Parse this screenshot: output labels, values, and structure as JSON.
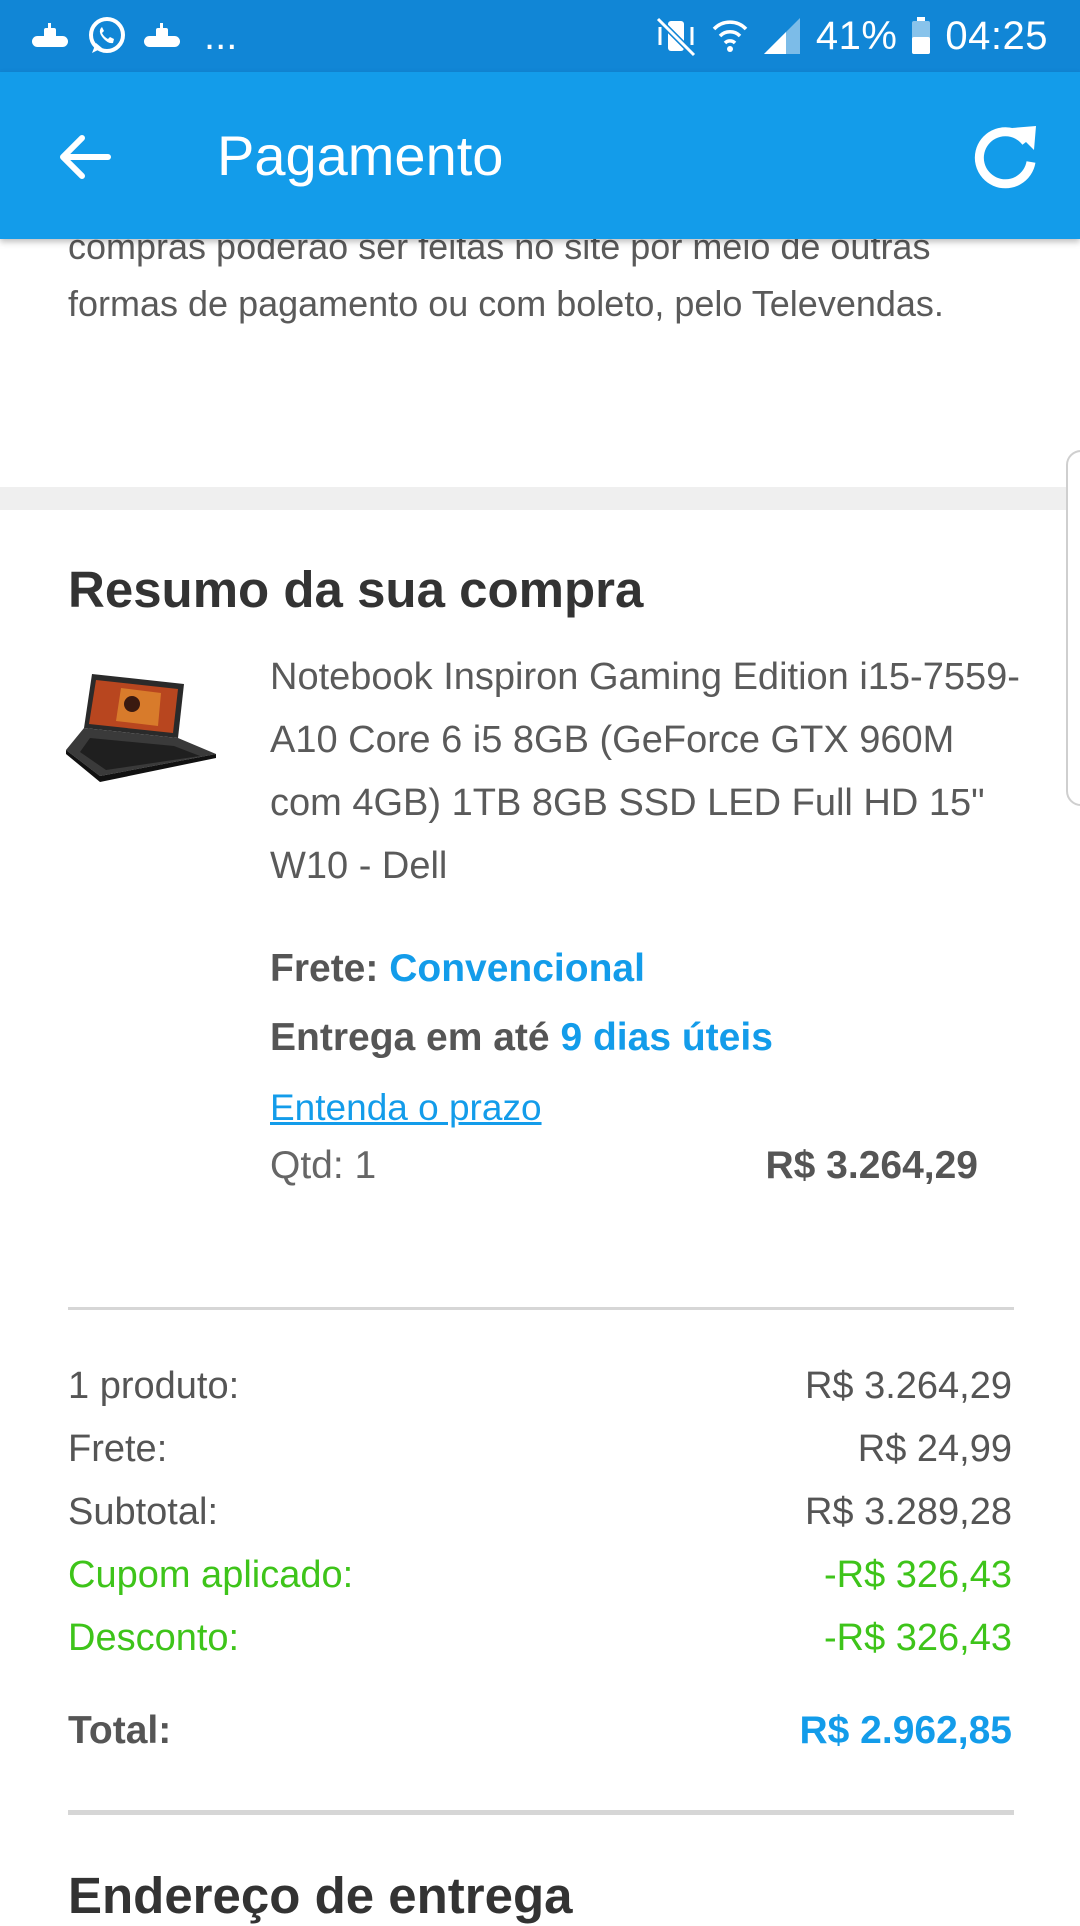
{
  "status_bar": {
    "left_icons": [
      "submarine-icon",
      "whatsapp-icon",
      "submarine-icon"
    ],
    "overflow": "...",
    "battery": "41%",
    "time": "04:25"
  },
  "app_bar": {
    "title": "Pagamento",
    "back_icon": "arrow-left-icon",
    "refresh_icon": "refresh-icon"
  },
  "intro": {
    "text": "compras poderão ser feitas no site por meio de outras formas de pagamento ou com boleto, pelo Televendas."
  },
  "summary": {
    "title": "Resumo da sua compra",
    "product": {
      "name": "Notebook Inspiron Gaming Edition i15-7559-A10 Core 6 i5 8GB (GeForce GTX 960M com 4GB) 1TB 8GB SSD LED Full HD 15\" W10 - Dell",
      "shipping_label": "Frete:",
      "shipping_value": "Convencional",
      "delivery_label": "Entrega em até",
      "delivery_value": "9 dias úteis",
      "terms_link": "Entenda o prazo",
      "qty": "Qtd: 1",
      "price": "R$ 3.264,29"
    },
    "rows": [
      {
        "label": "1 produto:",
        "value": "R$ 3.264,29"
      },
      {
        "label": "Frete:",
        "value": "R$ 24,99"
      },
      {
        "label": "Subtotal:",
        "value": "R$ 3.289,28"
      },
      {
        "label": "Cupom aplicado:",
        "value": "-R$ 326,43"
      },
      {
        "label": "Desconto:",
        "value": "-R$ 326,43"
      }
    ],
    "total": {
      "label": "Total:",
      "value": "R$ 2.962,85"
    }
  },
  "address": {
    "title": "Endereço de entrega"
  },
  "colors": {
    "status_bar": "#1186d6",
    "app_bar": "#139cea",
    "accent": "#139cea",
    "discount_green": "#3ec41a"
  }
}
